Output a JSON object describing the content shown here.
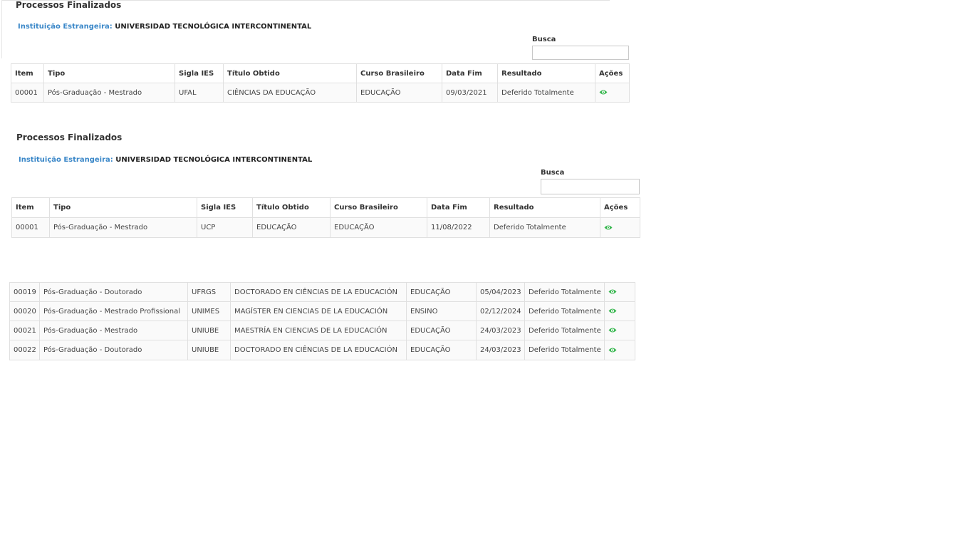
{
  "icons": {
    "view": "eye-icon"
  },
  "colors": {
    "label_blue": "#3a87c8",
    "eye_green": "#3cb853"
  },
  "section1": {
    "title": "Processos Finalizados",
    "institution_label": "Instituição Estrangeira:",
    "institution_value": "UNIVERSIDAD TECNOLÓGICA INTERCONTINENTAL",
    "search_label": "Busca",
    "search_value": "",
    "headers": [
      "Item",
      "Tipo",
      "Sigla IES",
      "Título Obtido",
      "Curso Brasileiro",
      "Data Fim",
      "Resultado",
      "Ações"
    ],
    "rows": [
      [
        "00001",
        "Pós-Graduação - Mestrado",
        "UFAL",
        "CIÊNCIAS DA EDUCAÇÃO",
        "EDUCAÇÃO",
        "09/03/2021",
        "Deferido Totalmente"
      ]
    ]
  },
  "section2": {
    "title": "Processos Finalizados",
    "institution_label": "Instituição Estrangeira:",
    "institution_value": "UNIVERSIDAD TECNOLÓGICA INTERCONTINENTAL",
    "search_label": "Busca",
    "search_value": "",
    "headers": [
      "Item",
      "Tipo",
      "Sigla IES",
      "Título Obtido",
      "Curso Brasileiro",
      "Data Fim",
      "Resultado",
      "Ações"
    ],
    "rows": [
      [
        "00001",
        "Pós-Graduação - Mestrado",
        "UCP",
        "EDUCAÇÃO",
        "EDUCAÇÃO",
        "11/08/2022",
        "Deferido Totalmente"
      ]
    ]
  },
  "section3": {
    "rows": [
      [
        "00019",
        "Pós-Graduação - Doutorado",
        "UFRGS",
        "DOCTORADO EN CIÊNCIAS DE LA EDUCACIÓN",
        "EDUCAÇÃO",
        "05/04/2023",
        "Deferido Totalmente"
      ],
      [
        "00020",
        "Pós-Graduação - Mestrado Profissional",
        "UNIMES",
        "MAGÍSTER EN CIENCIAS DE LA EDUCACIÓN",
        "ENSINO",
        "02/12/2024",
        "Deferido Totalmente"
      ],
      [
        "00021",
        "Pós-Graduação - Mestrado",
        "UNIUBE",
        "MAESTRÍA EN CIENCIAS DE LA EDUCACIÓN",
        "EDUCAÇÃO",
        "24/03/2023",
        "Deferido Totalmente"
      ],
      [
        "00022",
        "Pós-Graduação - Doutorado",
        "UNIUBE",
        "DOCTORADO EN CIÊNCIAS DE LA EDUCACIÓN",
        "EDUCAÇÃO",
        "24/03/2023",
        "Deferido Totalmente"
      ]
    ]
  }
}
